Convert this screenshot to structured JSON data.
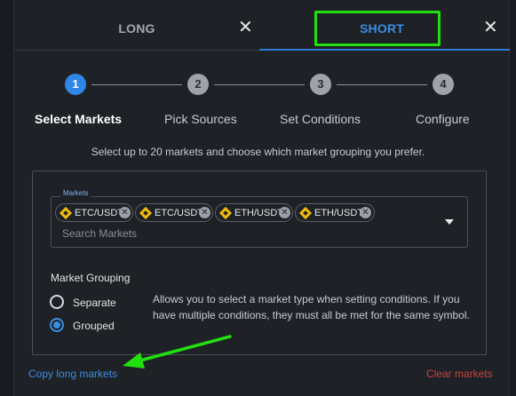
{
  "tabs": [
    {
      "label": "LONG",
      "active": false
    },
    {
      "label": "SHORT",
      "active": true
    }
  ],
  "close_glyph": "✕",
  "steps": [
    {
      "number": "1",
      "label": "Select Markets",
      "active": true
    },
    {
      "number": "2",
      "label": "Pick Sources",
      "active": false
    },
    {
      "number": "3",
      "label": "Set Conditions",
      "active": false
    },
    {
      "number": "4",
      "label": "Configure",
      "active": false
    }
  ],
  "instructions": "Select up to 20 markets and choose which market grouping you prefer.",
  "markets": {
    "legend": "Markets",
    "chips": [
      {
        "label": "ETC/USDT",
        "icon": "binance-icon"
      },
      {
        "label": "ETC/USDT",
        "icon": "binance-icon"
      },
      {
        "label": "ETH/USDT",
        "icon": "binance-icon"
      },
      {
        "label": "ETH/USDT",
        "icon": "binance-icon"
      }
    ],
    "remove_glyph": "✕",
    "search_placeholder": "Search Markets",
    "search_value": ""
  },
  "grouping": {
    "title": "Market Grouping",
    "options": [
      {
        "label": "Separate",
        "checked": false
      },
      {
        "label": "Grouped",
        "checked": true
      }
    ],
    "description": "Allows you to select a market type when setting conditions. If you have multiple conditions, they must all be met for the same symbol."
  },
  "footer": {
    "copy_label": "Copy long markets",
    "clear_label": "Clear markets"
  },
  "colors": {
    "background": "#1e2126",
    "accent": "#3a8ee3",
    "danger": "#c9453f",
    "annotation": "#22e00f",
    "coin": "#f0b90b"
  }
}
